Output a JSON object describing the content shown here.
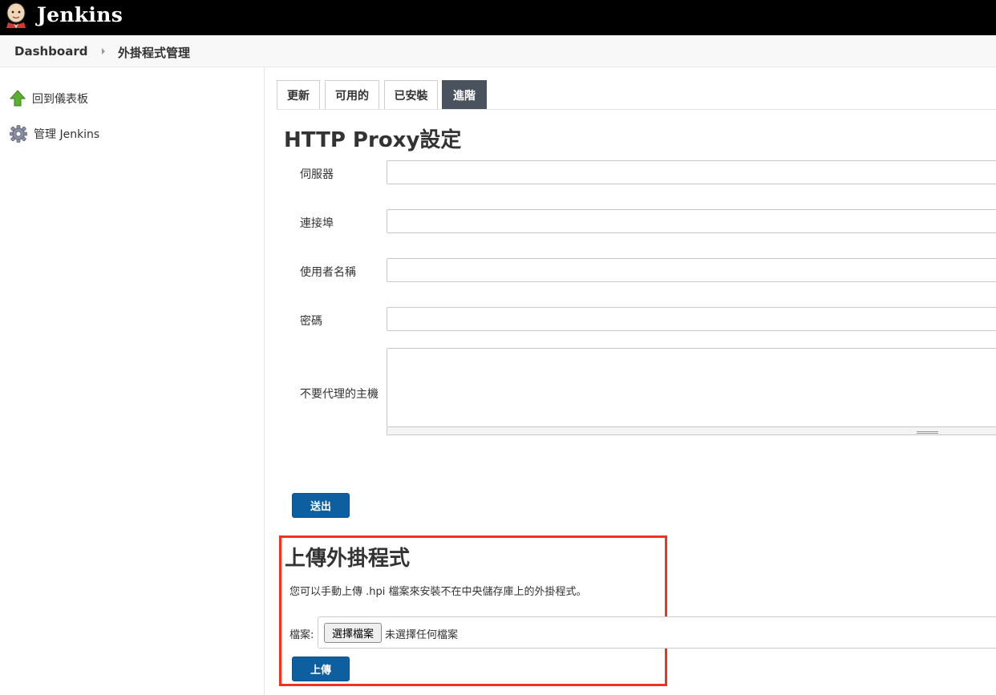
{
  "header": {
    "app_name": "Jenkins"
  },
  "breadcrumb": {
    "items": [
      "Dashboard",
      "外掛程式管理"
    ]
  },
  "sidebar": {
    "items": [
      {
        "label": "回到儀表板",
        "icon": "up-arrow-icon"
      },
      {
        "label": "管理 Jenkins",
        "icon": "gear-icon"
      }
    ]
  },
  "tabs": [
    {
      "label": "更新",
      "active": false
    },
    {
      "label": "可用的",
      "active": false
    },
    {
      "label": "已安裝",
      "active": false
    },
    {
      "label": "進階",
      "active": true
    }
  ],
  "proxy": {
    "title": "HTTP Proxy設定",
    "fields": [
      {
        "label": "伺服器",
        "value": ""
      },
      {
        "label": "連接埠",
        "value": ""
      },
      {
        "label": "使用者名稱",
        "value": ""
      },
      {
        "label": "密碼",
        "value": ""
      },
      {
        "label": "不要代理的主機",
        "value": ""
      }
    ],
    "submit_label": "送出"
  },
  "upload": {
    "title": "上傳外掛程式",
    "description": "您可以手動上傳 .hpi 檔案來安裝不在中央儲存庫上的外掛程式。",
    "file_label": "檔案:",
    "choose_button": "選擇檔案",
    "file_status": "未選擇任何檔案",
    "upload_label": "上傳"
  },
  "colors": {
    "header_bg": "#000000",
    "active_tab": "#4a525e",
    "primary_button": "#0d5fa0",
    "highlight_border": "#f2311e"
  }
}
